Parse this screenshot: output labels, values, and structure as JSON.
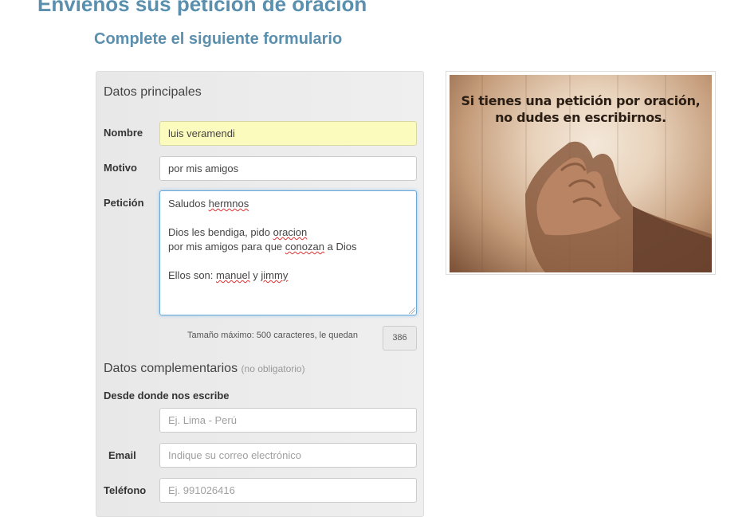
{
  "header": {
    "title": "Envíenos sus petición de oración",
    "subtitle": "Complete el siguiente formulario"
  },
  "form": {
    "main_section_title": "Datos principales",
    "nombre": {
      "label": "Nombre",
      "value": "luis veramendi"
    },
    "motivo": {
      "label": "Motivo",
      "value": "por mis amigos"
    },
    "peticion": {
      "label": "Petición",
      "lines": [
        "Saludos hermnos",
        "",
        "Dios les bendiga, pido oracion",
        "por mis amigos para que conozan a Dios",
        "",
        "Ellos son: manuel y jimmy"
      ]
    },
    "max_note": "Tamaño máximo: 500 caracteres, le quedan",
    "remaining": "386",
    "complementary_section_title": "Datos complementarios",
    "complementary_note": "(no obligatorio)",
    "ubicacion": {
      "label": "Desde donde nos escribe",
      "placeholder": "Ej. Lima - Perú"
    },
    "email": {
      "label": "Email",
      "placeholder": "Indique su correo electrónico"
    },
    "telefono": {
      "label": "Teléfono",
      "placeholder": "Ej. 991026416"
    }
  },
  "image": {
    "caption_line1": "Si tienes una petición por oración,",
    "caption_line2": "no dudes en escribirnos."
  },
  "colors": {
    "heading": "#5b8fae",
    "panel_bg": "#ececec",
    "highlight_field": "#fbfbbd",
    "focus_border": "#6aa8d8"
  }
}
